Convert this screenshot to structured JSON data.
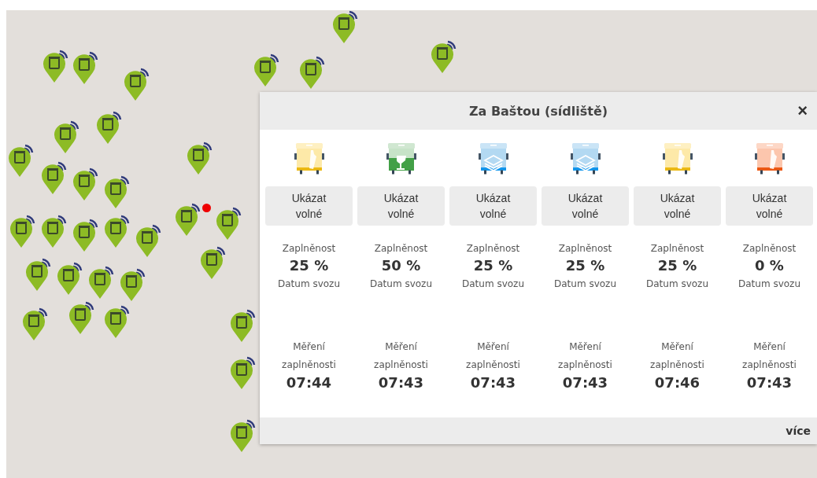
{
  "popup": {
    "title": "Za Baštou (sídliště)",
    "close": "×",
    "more": "více",
    "containers": [
      {
        "kind": "bottle",
        "color": "#fde9a8",
        "button": "Ukázat volné",
        "fill_label": "Zaplněnost",
        "fill_value": "25 %",
        "pickup_label": "Datum svozu",
        "measure_label": "Měření zaplněnosti",
        "measure_time": "07:44"
      },
      {
        "kind": "glass",
        "color": "#43a047",
        "button": "Ukázat volné",
        "fill_label": "Zaplněnost",
        "fill_value": "50 %",
        "pickup_label": "Datum svozu",
        "measure_label": "Měření zaplněnosti",
        "measure_time": "07:43"
      },
      {
        "kind": "paper",
        "color": "#b3d9f2",
        "button": "Ukázat volné",
        "fill_label": "Zaplněnost",
        "fill_value": "25 %",
        "pickup_label": "Datum svozu",
        "measure_label": "Měření zaplněnosti",
        "measure_time": "07:43"
      },
      {
        "kind": "paper",
        "color": "#b3d9f2",
        "button": "Ukázat volné",
        "fill_label": "Zaplněnost",
        "fill_value": "25 %",
        "pickup_label": "Datum svozu",
        "measure_label": "Měření zaplněnosti",
        "measure_time": "07:43"
      },
      {
        "kind": "bottle",
        "color": "#fde9a8",
        "button": "Ukázat volné",
        "fill_label": "Zaplněnost",
        "fill_value": "25 %",
        "pickup_label": "Datum svozu",
        "measure_label": "Měření zaplněnosti",
        "measure_time": "07:46"
      },
      {
        "kind": "bottle",
        "color": "#fcc6ad",
        "button": "Ukázat volné",
        "fill_label": "Zaplněnost",
        "fill_value": "0 %",
        "pickup_label": "Datum svozu",
        "measure_label": "Měření zaplněnosti",
        "measure_time": "07:43"
      }
    ]
  }
}
